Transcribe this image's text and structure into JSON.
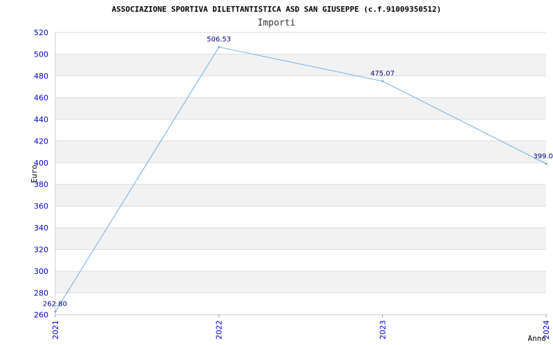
{
  "colors": {
    "line": "#6aaee8",
    "band": "#f2f2f2",
    "grid": "#dddddd",
    "tick_text": "#0000cc",
    "data_label": "#000080"
  },
  "chart_data": {
    "type": "line",
    "title": "ASSOCIAZIONE SPORTIVA DILETTANTISTICA ASD SAN GIUSEPPE (c.f.91009350512)",
    "subtitle": "Importi",
    "xlabel": "Anno",
    "ylabel": "Euro",
    "categories": [
      "2021",
      "2022",
      "2023",
      "2024"
    ],
    "series": [
      {
        "values": [
          262.8,
          506.53,
          475.07,
          399.0
        ],
        "labels": [
          "262.80",
          "506.53",
          "475.07",
          "399.0"
        ]
      }
    ],
    "ylim": [
      260,
      520
    ],
    "yticks": [
      260,
      280,
      300,
      320,
      340,
      360,
      380,
      400,
      420,
      440,
      460,
      480,
      500,
      520
    ],
    "grid": true,
    "alternating_bands": true
  }
}
